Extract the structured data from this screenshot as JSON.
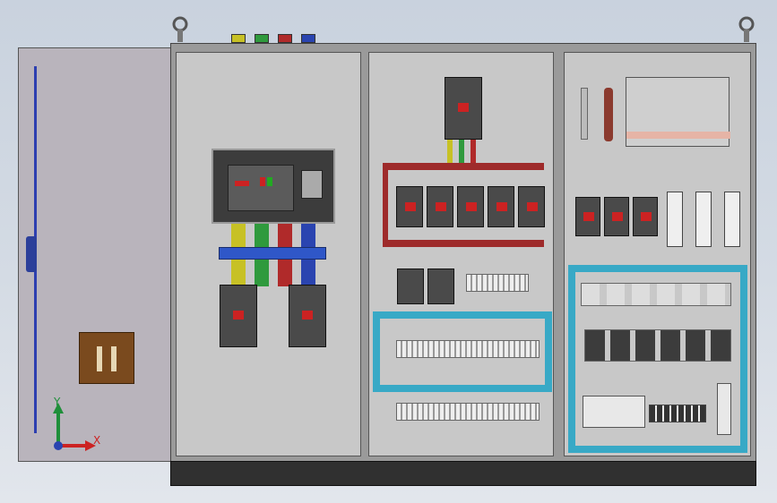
{
  "triad": {
    "x_label": "X",
    "y_label": "Y"
  },
  "colors": {
    "cabinet": "#c8c8c8",
    "door": "#b9b4bc",
    "busbar_red": "#9e2b2b",
    "duct_blue": "#38a9c6",
    "breaker": "#4a4a4a",
    "plinth": "#303030"
  }
}
